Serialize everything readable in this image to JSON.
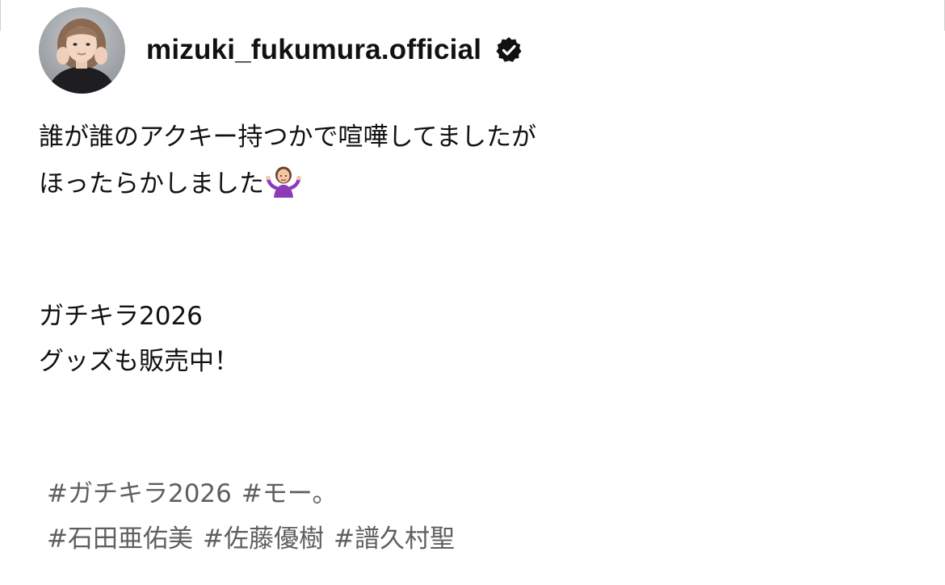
{
  "post": {
    "username": "mizuki_fukumura.official",
    "verified": true,
    "avatar": "profile-photo",
    "verified_icon": "verified-badge-icon",
    "caption": {
      "line_1": "誰が誰のアクキー持つかで喧嘩してましたが",
      "line_2": "ほったらかしました",
      "emoji": "person-shrugging-emoji",
      "line_3": "ガチキラ2026",
      "line_4": "グッズも販売中！"
    },
    "hashtags": {
      "row_1": [
        "#ガチキラ2026",
        "#モー。"
      ],
      "row_2": [
        "#石田亜佑美",
        "#佐藤優樹",
        "#譜久村聖"
      ]
    },
    "colors": {
      "text": "#111111",
      "hashtag": "#5f5f5f",
      "background": "#ffffff"
    }
  }
}
